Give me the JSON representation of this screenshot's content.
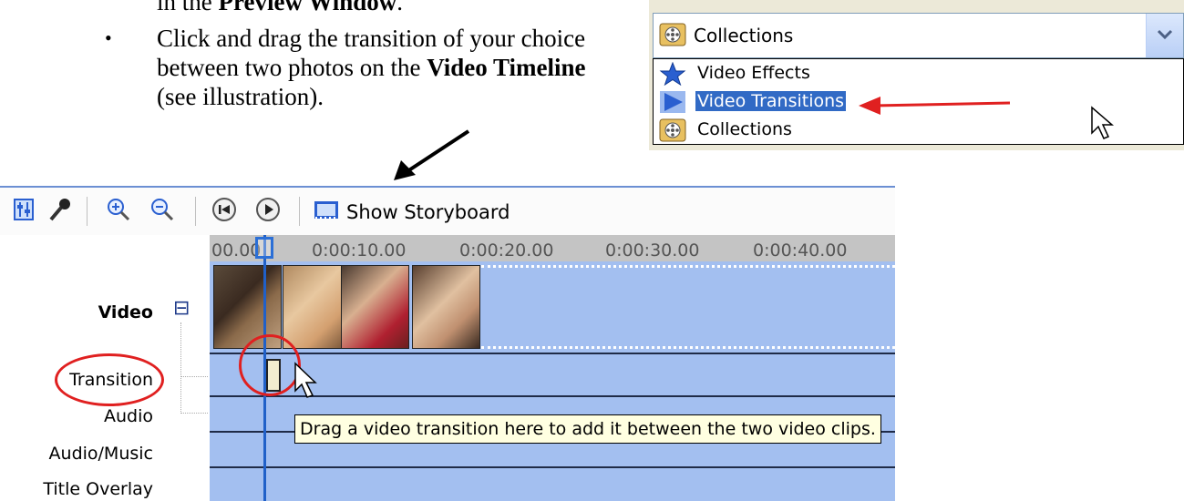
{
  "doc": {
    "line1_prefix": "in the ",
    "line1_bold": "Preview Window",
    "line1_suffix": ".",
    "bullet": "•",
    "para_part1": "Click and drag the transition of your choice between two photos on the ",
    "para_bold": "Video Timeline",
    "para_part2": " (see illustration)."
  },
  "dropdown": {
    "selected": "Collections",
    "items": [
      "Video Effects",
      "Video Transitions",
      "Collections"
    ],
    "highlighted_index": 1
  },
  "toolbar": {
    "show_storyboard": "Show Storyboard"
  },
  "timeline": {
    "ruler_ticks": [
      "00.00",
      "0:00:10.00",
      "0:00:20.00",
      "0:00:30.00",
      "0:00:40.00"
    ],
    "tracks": [
      "Video",
      "Transition",
      "Audio",
      "Audio/Music",
      "Title Overlay"
    ],
    "collapse_symbol": "⊟",
    "tooltip": "Drag a video transition here to add it between the two video clips."
  },
  "colors": {
    "timeline_bg": "#a3bff0",
    "selection": "#316ac5",
    "annotation_red": "#e02020",
    "playhead": "#2060c8"
  }
}
